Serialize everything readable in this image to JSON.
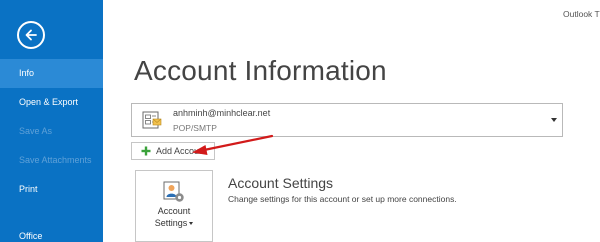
{
  "app": {
    "title": "Outlook T"
  },
  "sidebar": {
    "back_icon": "back-arrow-icon",
    "items": [
      {
        "label": "Info",
        "state": "active"
      },
      {
        "label": "Open & Export",
        "state": "normal"
      },
      {
        "label": "Save As",
        "state": "disabled"
      },
      {
        "label": "Save Attachments",
        "state": "disabled"
      },
      {
        "label": "Print",
        "state": "normal"
      },
      {
        "label": "Office",
        "state": "normal"
      }
    ]
  },
  "main": {
    "title": "Account Information",
    "account": {
      "email": "anhminh@minhclear.net",
      "type": "POP/SMTP",
      "icon": "account-card-icon"
    },
    "add_account_label": "Add Account",
    "account_settings": {
      "tile_line1": "Account",
      "tile_line2": "Settings",
      "heading": "Account Settings",
      "description": "Change settings for this account or set up more connections."
    }
  },
  "colors": {
    "sidebar_bg": "#0a72c4",
    "sidebar_active": "#2b8ad6",
    "annotation_arrow": "#d21a1a",
    "plus_green": "#3aa23a"
  }
}
